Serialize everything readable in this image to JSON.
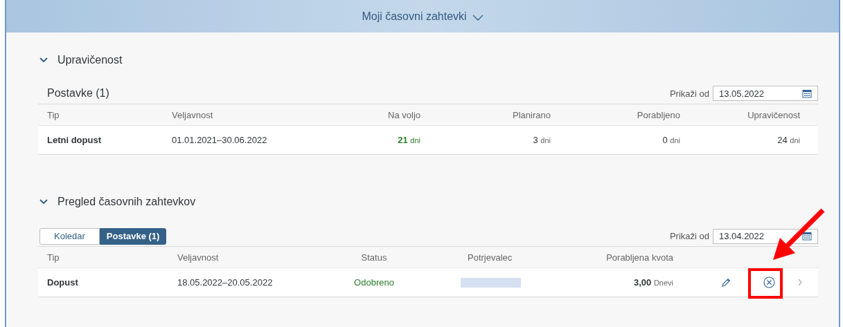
{
  "header": {
    "title": "Moji časovni zahtevki"
  },
  "sections": [
    {
      "title": "Upravičenost",
      "expanded": true,
      "table": {
        "title": "Postavke (1)",
        "filter_label": "Prikaži od",
        "filter_value": "13.05.2022",
        "columns": [
          "Tip",
          "Veljavnost",
          "Na voljo",
          "Planirano",
          "Porabljeno",
          "Upravičenost"
        ],
        "rows": [
          {
            "type": "Letni dopust",
            "validity": "01.01.2021–30.06.2022",
            "amounts": [
              {
                "value": "21",
                "unit": "dni",
                "highlight": true
              },
              {
                "value": "3",
                "unit": "dni",
                "highlight": false
              },
              {
                "value": "0",
                "unit": "dni",
                "highlight": false
              },
              {
                "value": "24",
                "unit": "dni",
                "highlight": false
              }
            ]
          }
        ]
      }
    },
    {
      "title": "Pregled časovnih zahtevkov",
      "expanded": true,
      "tabs": [
        {
          "label": "Koledar",
          "selected": false
        },
        {
          "label": "Postavke (1)",
          "selected": true
        }
      ],
      "table": {
        "filter_label": "Prikaži od",
        "filter_value": "13.04.2022",
        "columns": [
          "Tip",
          "Veljavnost",
          "Status",
          "Potrjevalec",
          "Porabljena kvota"
        ],
        "rows": [
          {
            "type": "Dopust",
            "validity": "18.05.2022–20.05.2022",
            "status": "Odobreno",
            "approved": true,
            "quota_value": "3,00",
            "quota_unit": "Dnevi"
          }
        ]
      }
    }
  ]
}
